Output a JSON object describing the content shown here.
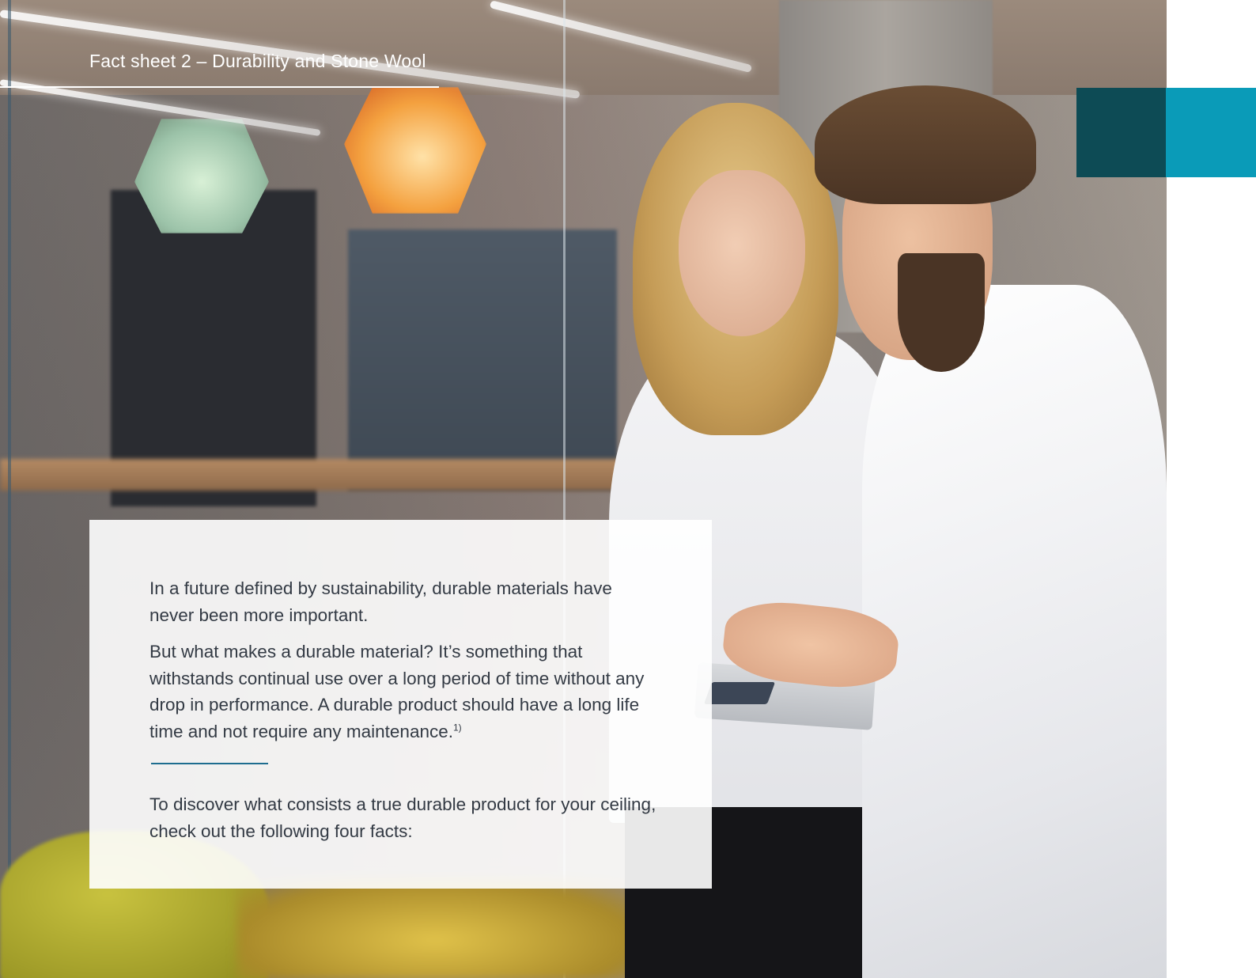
{
  "header": {
    "title": "Fact sheet 2 – Durability and Stone Wool"
  },
  "colors": {
    "accent_dark": "#0d4b55",
    "accent_light": "#0a9bb8",
    "divider": "#1e6d8f",
    "body_text": "#333a44"
  },
  "card": {
    "paragraph_1": "In a future defined by sustainability, durable materials have never been more important.",
    "paragraph_2": "But what makes a durable material? It’s something that withstands continual use over a long period of time without any drop in performance. A durable product should have a long life time and not require any maintenance.",
    "footnote_marker": "1)",
    "paragraph_3": "To discover what consists a true durable product for your ceiling, check out the following four facts:"
  }
}
